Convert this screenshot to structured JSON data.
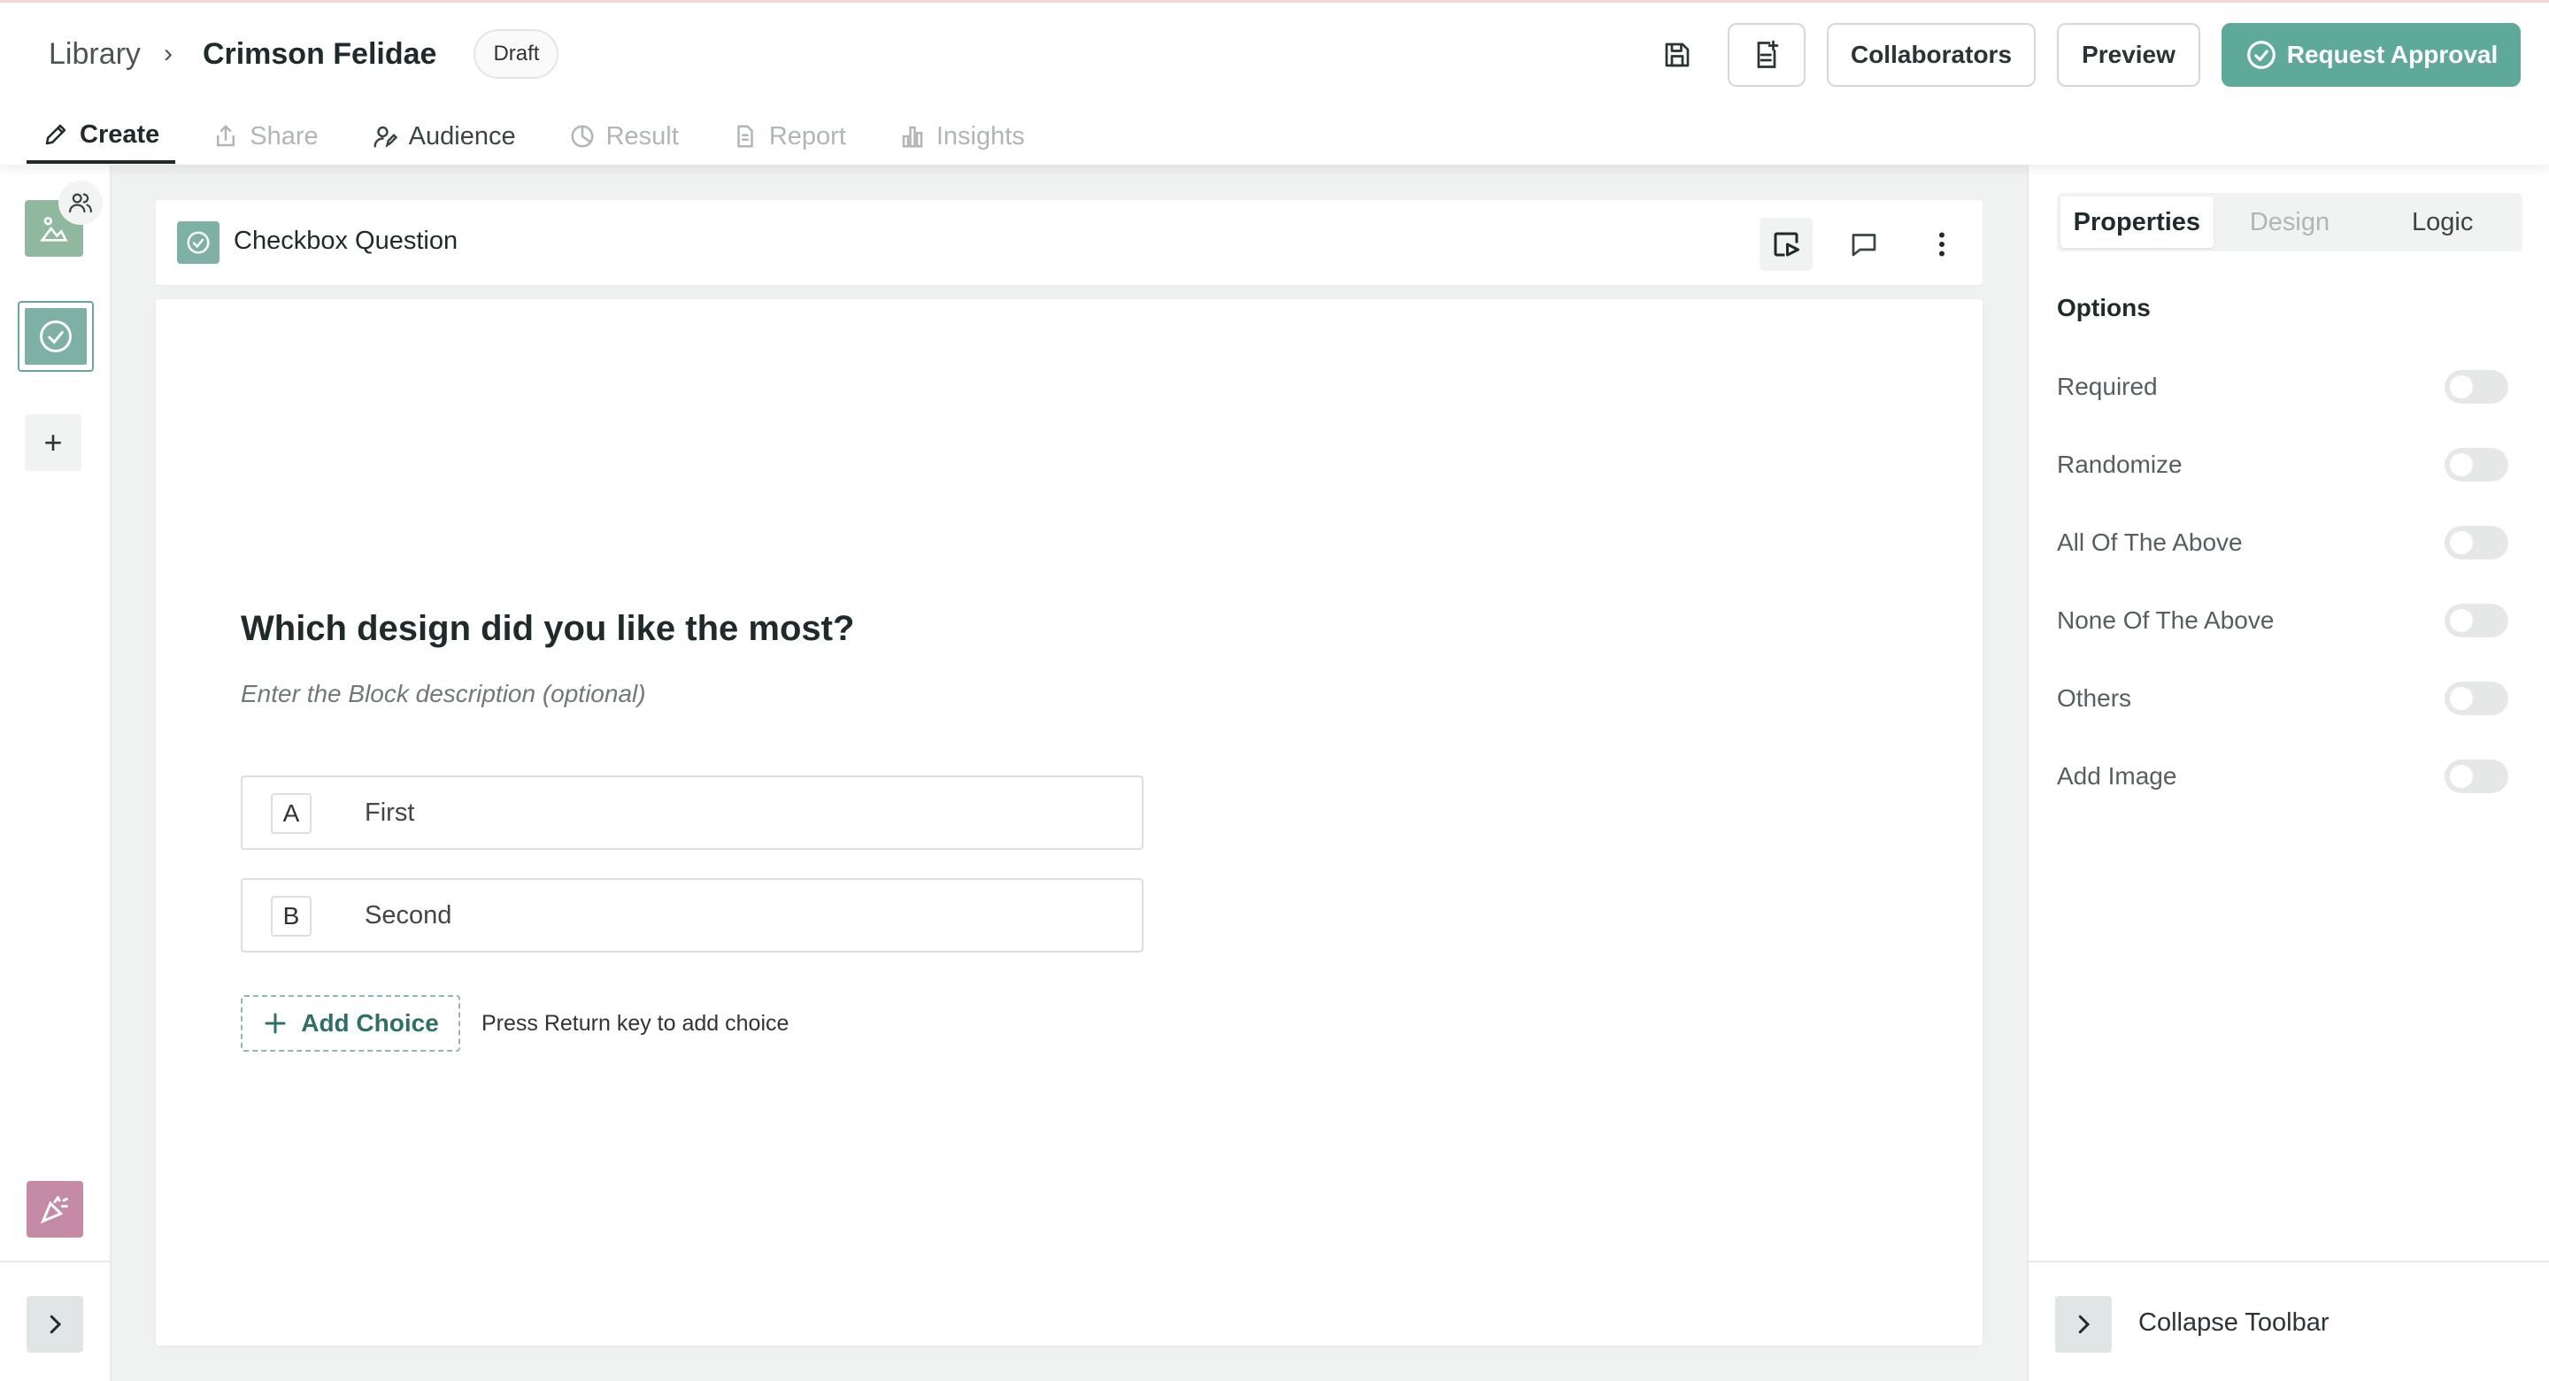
{
  "breadcrumb": {
    "library": "Library",
    "separator": "›",
    "title": "Crimson Felidae",
    "status": "Draft"
  },
  "header": {
    "collaborators_label": "Collaborators",
    "preview_label": "Preview",
    "approve_label": "Request Approval",
    "accent_color": "#5fa99a"
  },
  "tabs": [
    {
      "label": "Create",
      "icon": "pencil-icon",
      "active": true
    },
    {
      "label": "Share",
      "icon": "share-icon"
    },
    {
      "label": "Audience",
      "icon": "audience-icon"
    },
    {
      "label": "Result",
      "icon": "pie-icon"
    },
    {
      "label": "Report",
      "icon": "document-icon"
    },
    {
      "label": "Insights",
      "icon": "bar-chart-icon"
    }
  ],
  "left_sidebar": {
    "add_label": "+"
  },
  "question_bar": {
    "type_label": "Checkbox Question"
  },
  "question": {
    "title": "Which design did you like the most?",
    "description": "Enter the Block description (optional)",
    "choices": [
      {
        "key": "A",
        "text": "First"
      },
      {
        "key": "B",
        "text": "Second"
      }
    ],
    "add_choice_label": "Add Choice",
    "hint": "Press Return key to add choice"
  },
  "right_panel": {
    "tabs": [
      {
        "label": "Properties",
        "active": true
      },
      {
        "label": "Design"
      },
      {
        "label": "Logic"
      }
    ],
    "options_heading": "Options",
    "options": [
      {
        "label": "Required",
        "on": false
      },
      {
        "label": "Randomize",
        "on": false
      },
      {
        "label": "All Of The Above",
        "on": false
      },
      {
        "label": "None Of The Above",
        "on": false
      },
      {
        "label": "Others",
        "on": false
      },
      {
        "label": "Add Image",
        "on": false
      }
    ],
    "collapse_label": "Collapse Toolbar"
  }
}
